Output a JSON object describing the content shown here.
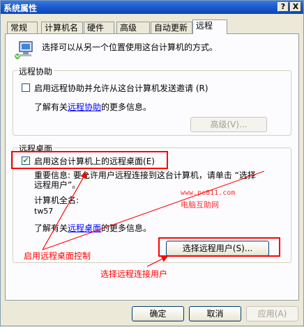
{
  "window": {
    "title": "系统属性",
    "help_btn": "?",
    "close_btn": "X"
  },
  "tabs": [
    {
      "label": "常规"
    },
    {
      "label": "计算机名"
    },
    {
      "label": "硬件"
    },
    {
      "label": "高级"
    },
    {
      "label": "自动更新"
    },
    {
      "label": "远程",
      "active": true
    }
  ],
  "intro": {
    "text": "选择可以从另一个位置使用这台计算机的方式。",
    "icon": "computer-network-icon"
  },
  "remote_assistance": {
    "title": "远程协助",
    "checkbox_label": "启用远程协助并允许从这台计算机发送邀请",
    "checkbox_key": "(R)",
    "checked": false,
    "info_prefix": "了解有关",
    "info_link": "远程协助",
    "info_suffix": "的更多信息。",
    "advanced_button": "高级(V)..."
  },
  "remote_desktop": {
    "title": "远程桌面",
    "checkbox_label": "启用这台计算机上的远程桌面",
    "checkbox_key": "(E)",
    "checked": true,
    "note_line1": "重要信息: 要允许用户远程连接到这台计算机，请单击 “选择",
    "note_line2": "远程用户”。",
    "full_name_label": "计算机全名:",
    "full_name_value": "tw57",
    "info_prefix": "了解有关",
    "info_link": "远程桌面",
    "info_suffix": "的更多信息。",
    "select_users_button": "选择远程用户(S)..."
  },
  "watermark": {
    "url": "www.pc811.com",
    "name": "电脑互助网"
  },
  "annotations": {
    "enable_desktop": "启用远程桌面控制",
    "select_users": "选择远程连接用户",
    "color": "#ff0000"
  },
  "footer": {
    "ok": "确定",
    "cancel": "取消",
    "apply": "应用(A)"
  }
}
